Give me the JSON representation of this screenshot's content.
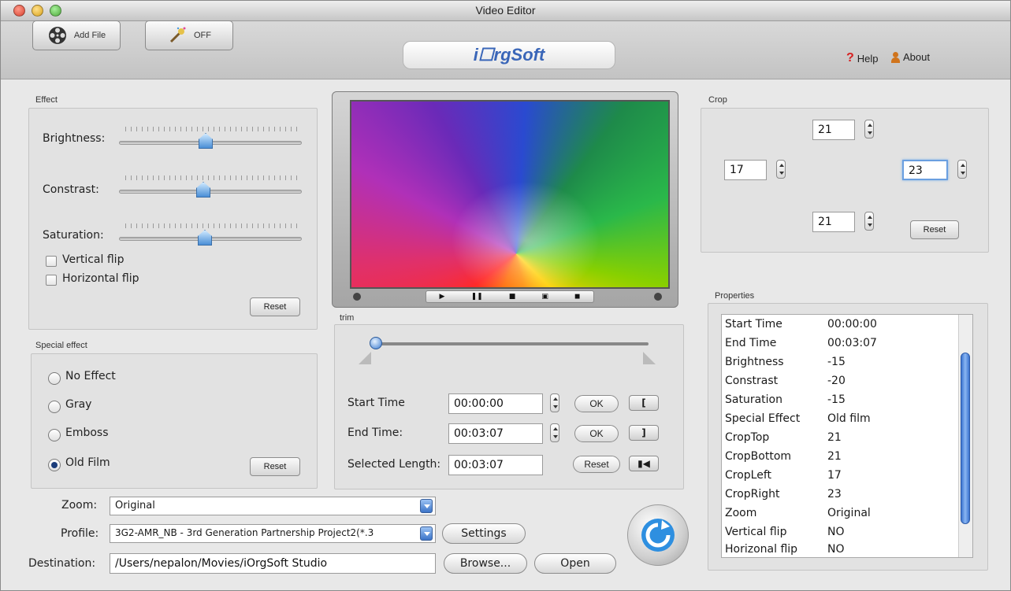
{
  "window": {
    "title": "Video Editor"
  },
  "toolbar": {
    "add_file": "Add File",
    "toggle": "OFF",
    "logo": "i☐rgSoft",
    "help": "Help",
    "about": "About"
  },
  "effect": {
    "label": "Effect",
    "brightness": "Brightness:",
    "contrast": "Constrast:",
    "saturation": "Saturation:",
    "vertical_flip": "Vertical flip",
    "horizontal_flip": "Horizontal flip",
    "reset": "Reset"
  },
  "special": {
    "label": "Special effect",
    "options": [
      "No Effect",
      "Gray",
      "Emboss",
      "Old Film"
    ],
    "selected": "Old Film",
    "reset": "Reset"
  },
  "trim": {
    "label": "trim",
    "start_label": "Start Time",
    "start_value": "00:00:00",
    "end_label": "End Time:",
    "end_value": "00:03:07",
    "length_label": "Selected Length:",
    "length_value": "00:03:07",
    "ok": "OK",
    "reset": "Reset"
  },
  "crop": {
    "label": "Crop",
    "top": "21",
    "left": "17",
    "right": "23",
    "bottom": "21",
    "reset": "Reset"
  },
  "properties": {
    "label": "Properties",
    "rows": [
      {
        "name": "Start Time",
        "value": "00:00:00"
      },
      {
        "name": "End Time",
        "value": "00:03:07"
      },
      {
        "name": "Brightness",
        "value": "-15"
      },
      {
        "name": "Constrast",
        "value": "-20"
      },
      {
        "name": "Saturation",
        "value": "-15"
      },
      {
        "name": "Special Effect",
        "value": "Old film"
      },
      {
        "name": "CropTop",
        "value": "21"
      },
      {
        "name": "CropBottom",
        "value": "21"
      },
      {
        "name": "CropLeft",
        "value": "17"
      },
      {
        "name": "CropRight",
        "value": "23"
      },
      {
        "name": "Zoom",
        "value": "Original"
      },
      {
        "name": "Vertical flip",
        "value": "NO"
      },
      {
        "name": "Horizonal flip",
        "value": "NO"
      }
    ]
  },
  "bottom": {
    "zoom_label": "Zoom:",
    "zoom_value": "Original",
    "profile_label": "Profile:",
    "profile_value": "3G2-AMR_NB - 3rd Generation Partnership Project2(*.3",
    "settings": "Settings",
    "destination_label": "Destination:",
    "destination_value": "/Users/nepalon/Movies/iOrgSoft Studio",
    "browse": "Browse...",
    "open": "Open"
  },
  "colors": {
    "accent": "#3b74c8",
    "logo": "#3a66b8"
  }
}
